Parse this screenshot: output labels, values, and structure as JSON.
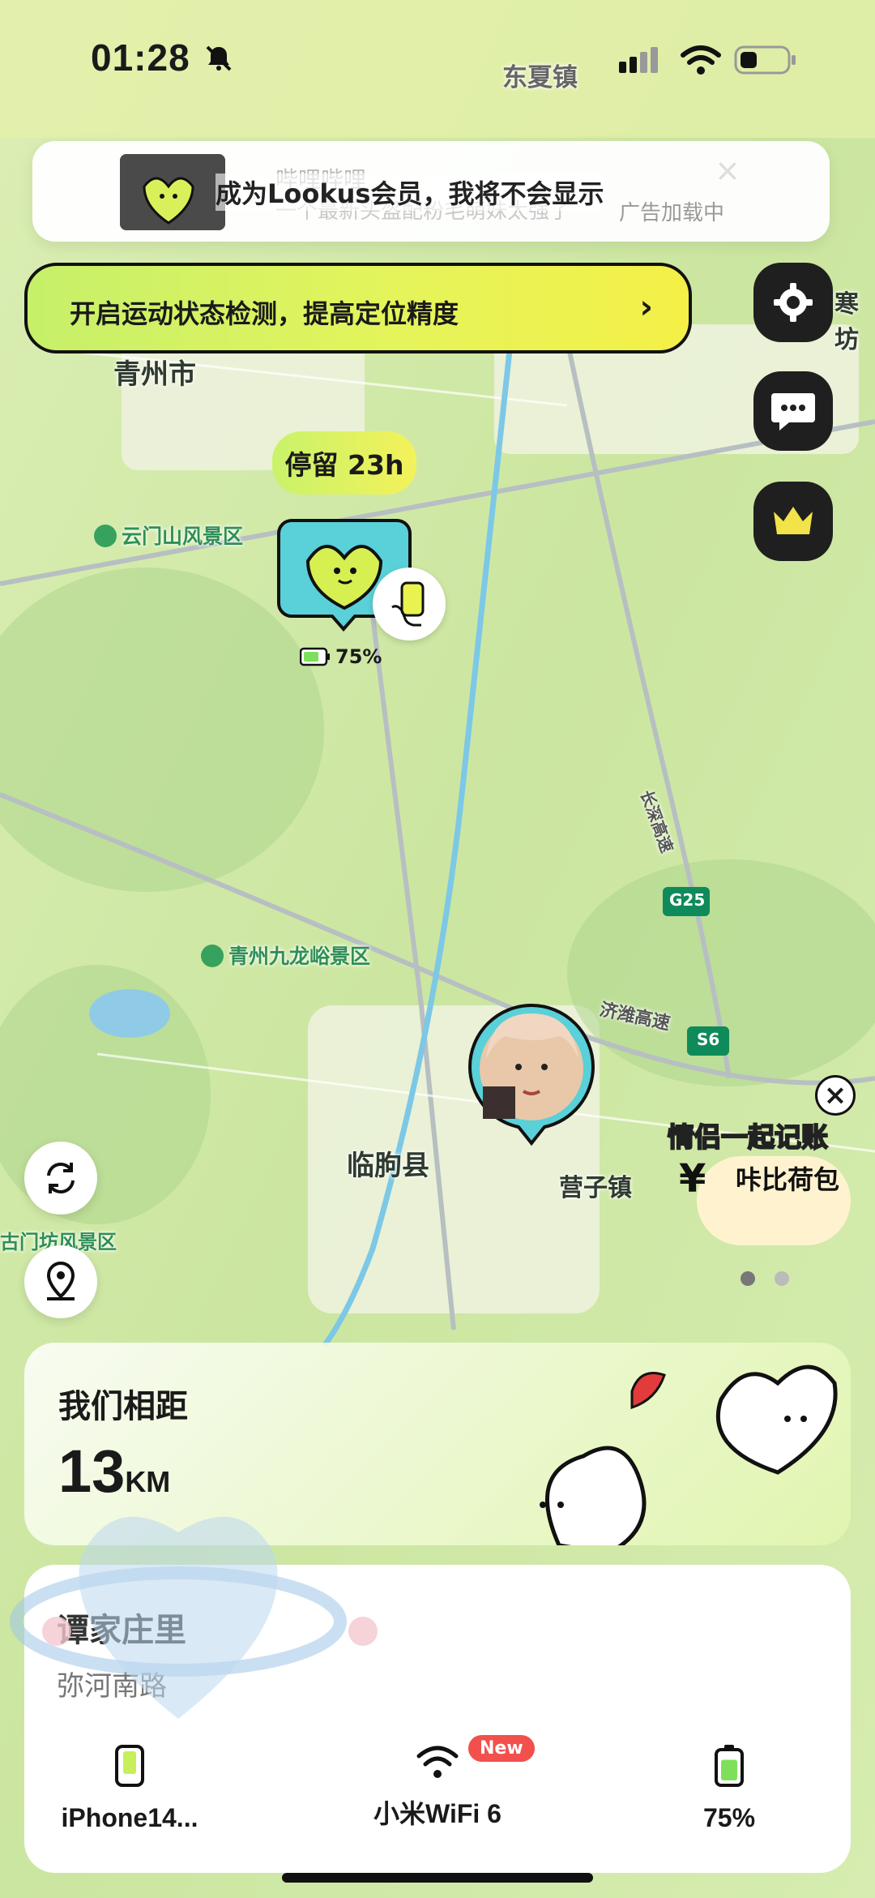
{
  "status_bar": {
    "time": "01:28",
    "silent_icon": "bell-slash-icon",
    "cellular_icon": "signal-icon",
    "wifi_icon": "wifi-icon",
    "battery_icon": "battery-icon"
  },
  "ad_banner": {
    "text": "成为Lookus会员，我将不会显示",
    "ghost_title": "哔哩哔哩",
    "ghost_subtitle": "一个最新头盔配粉毛萌妹太强了",
    "loading": "广告加载中"
  },
  "motion_banner": {
    "text": "开启运动状态检测，提高定位精度",
    "arrow": "›"
  },
  "side_buttons": [
    {
      "icon": "gear-icon"
    },
    {
      "icon": "chat-icon"
    },
    {
      "icon": "crown-icon"
    }
  ],
  "map": {
    "labels": {
      "dongxia": "东夏镇",
      "qingzhou": "青州市",
      "yunmen": "云门山风景区",
      "jiulong": "青州九龙峪景区",
      "linqu": "临朐县",
      "yingzi": "营子镇",
      "fengjing": "古门坊风景区",
      "fangzi": "寒坊",
      "changshen": "长深高速",
      "jinan": "济潍高速"
    },
    "shields": {
      "g25": "G25",
      "s6": "S6"
    }
  },
  "device_pin": {
    "stay": "停留 23h",
    "battery": "75%",
    "battery_level": 0.75
  },
  "promo": {
    "title": "情侣一起记账",
    "subtitle": "咔比荷包",
    "currency": "¥"
  },
  "page_dots": {
    "active": 0,
    "count": 2
  },
  "distance": {
    "label": "我们相距",
    "value": "13",
    "unit": "KM"
  },
  "address": {
    "line1": "谭家庄里",
    "line2": "弥河南路"
  },
  "device_stats": {
    "device": "iPhone14...",
    "wifi": "小米WiFi 6",
    "wifi_badge": "New",
    "battery": "75%"
  },
  "colors": {
    "accent_yellow": "#f2f04a",
    "accent_green": "#c6f06a",
    "badge_red": "#f2504c"
  }
}
